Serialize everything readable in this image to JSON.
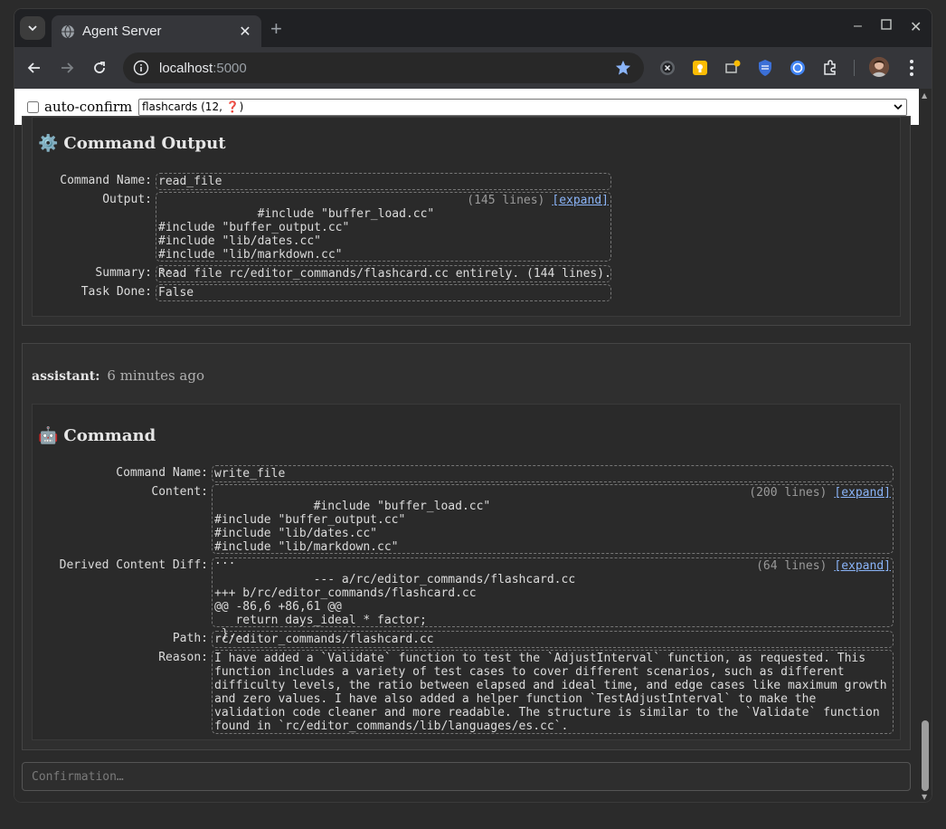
{
  "browser": {
    "tab_title": "Agent Server",
    "url_host": "localhost",
    "url_port": ":5000"
  },
  "topbar": {
    "auto_confirm_label": "auto-confirm",
    "auto_confirm_checked": false,
    "conversation_select": "flashcards (12, ❓)"
  },
  "command_output": {
    "emoji": "⚙️",
    "title": "Command Output",
    "fields": {
      "command_name_label": "Command Name:",
      "command_name": "read_file",
      "output_label": "Output:",
      "output": "#include \"buffer_load.cc\"\n#include \"buffer_output.cc\"\n#include \"lib/dates.cc\"\n#include \"lib/markdown.cc\"\n...",
      "output_lines": "(145 lines)",
      "expand": "[expand]",
      "summary_label": "Summary:",
      "summary": "Read file rc/editor_commands/flashcard.cc entirely. (144 lines).",
      "task_done_label": "Task Done:",
      "task_done": "False"
    }
  },
  "assistant_message": {
    "sender": "assistant:",
    "time": "6 minutes ago",
    "command": {
      "emoji": "🤖",
      "title": "Command",
      "command_name_label": "Command Name:",
      "command_name": "write_file",
      "content_label": "Content:",
      "content": "#include \"buffer_load.cc\"\n#include \"buffer_output.cc\"\n#include \"lib/dates.cc\"\n#include \"lib/markdown.cc\"\n...",
      "content_lines": "(200 lines)",
      "diff_label": "Derived Content Diff:",
      "diff": "--- a/rc/editor_commands/flashcard.cc\n+++ b/rc/editor_commands/flashcard.cc\n@@ -86,6 +86,61 @@\n   return days_ideal * factor;\n }...",
      "diff_lines": "(64 lines)",
      "expand": "[expand]",
      "path_label": "Path:",
      "path": "rc/editor_commands/flashcard.cc",
      "reason_label": "Reason:",
      "reason": "I have added a `Validate` function to test the `AdjustInterval` function, as requested. This\nfunction includes a variety of test cases to cover different scenarios, such as different\ndifficulty levels, the ratio between elapsed and ideal time, and edge cases like maximum growth\nand zero values. I have also added a helper function `TestAdjustInterval` to make the\nvalidation code cleaner and more readable. The structure is similar to the `Validate` function\nfound in `rc/editor_commands/lib/languages/es.cc`."
    }
  },
  "confirmation": {
    "placeholder": "Confirmation…"
  }
}
